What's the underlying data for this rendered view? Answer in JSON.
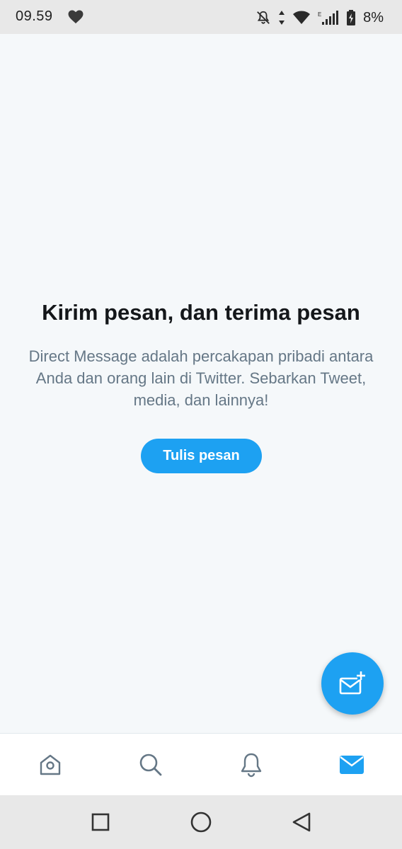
{
  "status_bar": {
    "time": "09.59",
    "battery_percent": "8%",
    "icons": [
      "heart-icon",
      "notifications-off-icon",
      "data-transfer-icon",
      "wifi-icon",
      "signal-icon",
      "battery-charging-icon"
    ]
  },
  "empty_state": {
    "title": "Kirim pesan, dan terima pesan",
    "description": "Direct Message adalah percakapan pribadi antara Anda dan orang lain di Twitter. Sebarkan Tweet, media, dan lainnya!",
    "button_label": "Tulis pesan"
  },
  "fab": {
    "icon": "new-message-icon"
  },
  "bottom_nav": {
    "items": [
      {
        "icon": "home-icon",
        "active": false
      },
      {
        "icon": "search-icon",
        "active": false
      },
      {
        "icon": "notifications-icon",
        "active": false
      },
      {
        "icon": "messages-icon",
        "active": true
      }
    ]
  },
  "system_nav": {
    "buttons": [
      "recents-icon",
      "home-circle-icon",
      "back-icon"
    ]
  },
  "colors": {
    "accent": "#1da1f2",
    "background": "#f5f8fa",
    "title_text": "#14171a",
    "secondary_text": "#657786",
    "nav_icon_inactive": "#657786"
  }
}
